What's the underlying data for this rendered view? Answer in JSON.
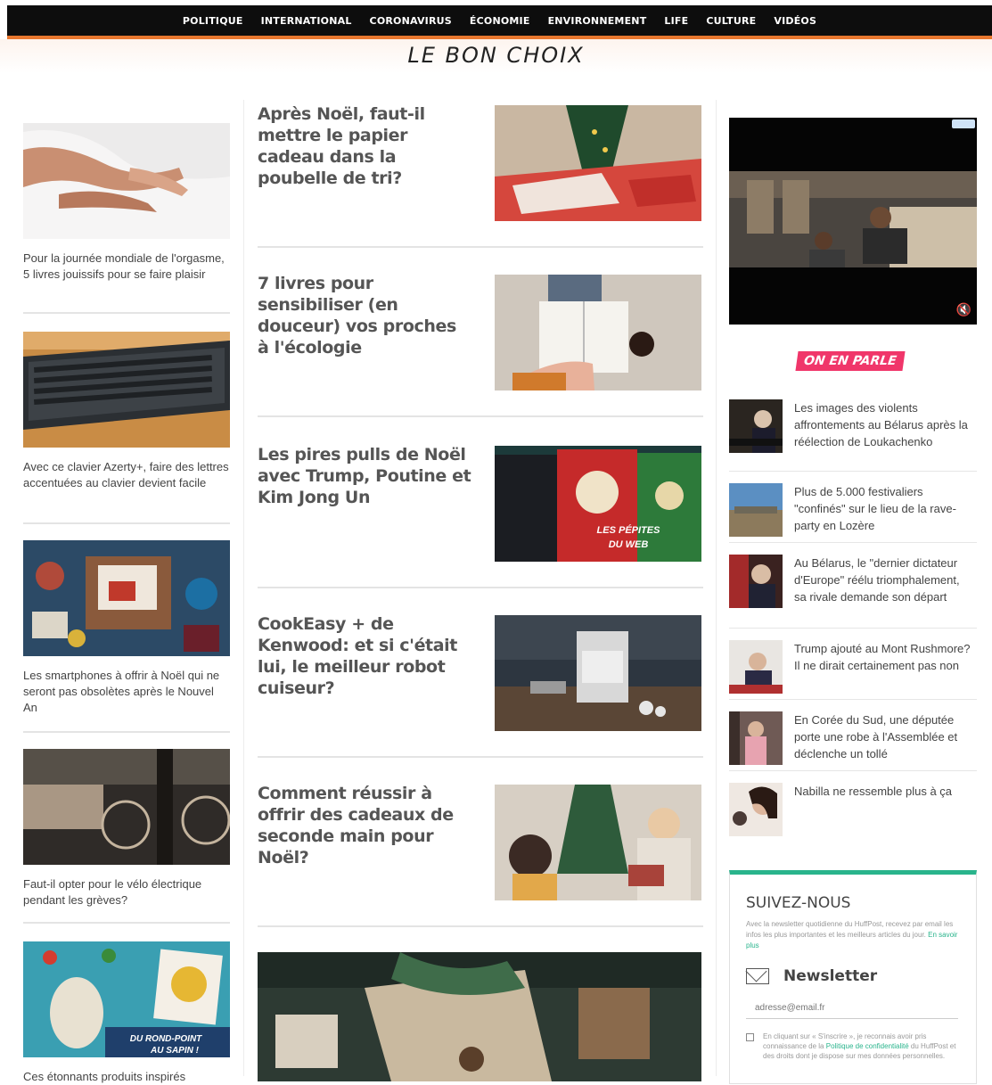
{
  "nav": [
    "POLITIQUE",
    "INTERNATIONAL",
    "CORONAVIRUS",
    "ÉCONOMIE",
    "ENVIRONNEMENT",
    "LIFE",
    "CULTURE",
    "VIDÉOS"
  ],
  "section_title": "LE BON CHOIX",
  "left_articles": [
    {
      "title": "Pour la journée mondiale de l'orgasme, 5 livres jouissifs pour se faire plaisir"
    },
    {
      "title": "Avec ce clavier Azerty+, faire des lettres accentuées au clavier devient facile"
    },
    {
      "title": "Les smartphones à offrir à Noël qui ne seront pas obsolètes après le Nouvel An"
    },
    {
      "title": "Faut-il opter pour le vélo électrique pendant les grèves?"
    },
    {
      "title": "Ces étonnants produits inspirés"
    }
  ],
  "main_articles": [
    {
      "title": "Après Noël, faut-il mettre le papier cadeau dans la poubelle de tri?"
    },
    {
      "title": "7 livres pour sensibiliser (en douceur) vos proches à l'écologie"
    },
    {
      "title": "Les pires pulls de Noël avec Trump, Poutine et Kim Jong Un"
    },
    {
      "title": "CookEasy + de Kenwood: et si c'était lui, le meilleur robot cuiseur?"
    },
    {
      "title": "Comment réussir à offrir des cadeaux de seconde main pour Noël?"
    }
  ],
  "image_overlays": {
    "pepites": [
      "LES PÉPITES",
      "DU WEB"
    ],
    "rond_point": [
      "DU ROND-POINT",
      "AU SAPIN !"
    ]
  },
  "sidebar": {
    "badge": "ON EN PARLE",
    "items": [
      {
        "title": "Les images des violents affrontements au Bélarus après la réélection de Loukachenko"
      },
      {
        "title": "Plus de 5.000 festivaliers \"confinés\" sur le lieu de la rave-party en Lozère"
      },
      {
        "title": "Au Bélarus, le \"dernier dictateur d'Europe\" réélu triomphalement, sa rivale demande son départ"
      },
      {
        "title": "Trump ajouté au Mont Rushmore? Il ne dirait certainement pas non"
      },
      {
        "title": "En Corée du Sud, une députée porte une robe à l'Assemblée et déclenche un tollé"
      },
      {
        "title": "Nabilla ne ressemble plus à ça"
      }
    ],
    "follow": {
      "heading": "SUIVEZ-NOUS",
      "description": "Avec la newsletter quotidienne du HuffPost, recevez par email les infos les plus importantes et les meilleurs articles du jour.",
      "more_link": "En savoir plus",
      "newsletter_label": "Newsletter",
      "email_placeholder": "adresse@email.fr",
      "consent_text": "En cliquant sur « S'inscrire », je reconnais avoir pris connaissance de la",
      "consent_link": "Politique de confidentialité",
      "consent_tail": "du HuffPost et des droits dont je dispose sur mes données personnelles."
    }
  },
  "colors": {
    "nav_bg": "#0d0d0d",
    "nav_accent": "#e8772e",
    "badge": "#f0366a",
    "follow_accent": "#29b48c"
  }
}
